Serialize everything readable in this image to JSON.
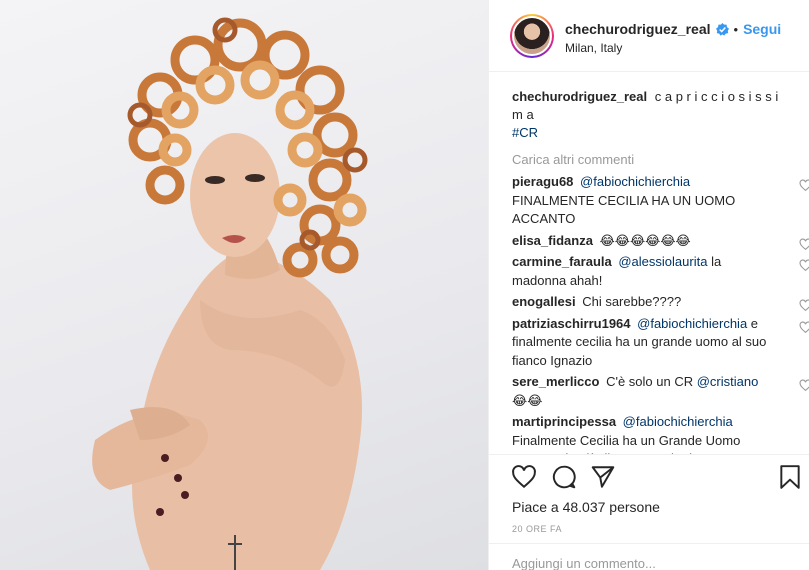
{
  "post": {
    "username": "chechurodriguez_real",
    "dot": "•",
    "follow_label": "Segui",
    "location": "Milan, Italy"
  },
  "caption": {
    "username": "chechurodriguez_real",
    "text": "c a p r i c c i o s i s s i m a",
    "hashtag": "#CR"
  },
  "load_more_label": "Carica altri commenti",
  "comments": [
    {
      "username": "pieragu68",
      "mention": "@fabiochichierchia",
      "text": "FINALMENTE CECILIA HA UN UOMO ACCANTO"
    },
    {
      "username": "elisa_fidanza",
      "mention": "",
      "text": "😂😂😂😂😂😂"
    },
    {
      "username": "carmine_faraula",
      "mention": "@alessiolaurita",
      "text": "la madonna ahah!"
    },
    {
      "username": "enogallesi",
      "mention": "",
      "text": "Chi sarebbe????"
    },
    {
      "username": "patriziaschirru1964",
      "mention": "@fabiochichierchia",
      "text": "e finalmente cecilia ha un grande uomo al suo fianco Ignazio"
    },
    {
      "username": "sere_merlicco",
      "mention": "",
      "text": "C'è solo un CR",
      "mention2": "@cristiano",
      "text2": "😂😂"
    },
    {
      "username": "martiprincipessa",
      "mention": "@fabiochichierchia",
      "text": "Finalmente Cecilia ha un Grande Uomo accanto da più di un anno che la tratta come una principessa...che grande"
    }
  ],
  "likes_label": "Piace a 48.037 persone",
  "time_ago": "20 ORE FA",
  "add_comment_placeholder": "Aggiungi un commento...",
  "colors": {
    "link": "#3897f0",
    "hashtag": "#003569",
    "muted": "#999999"
  },
  "icons": [
    "verified-badge-icon",
    "heart-icon",
    "comment-icon",
    "share-icon",
    "bookmark-icon"
  ]
}
